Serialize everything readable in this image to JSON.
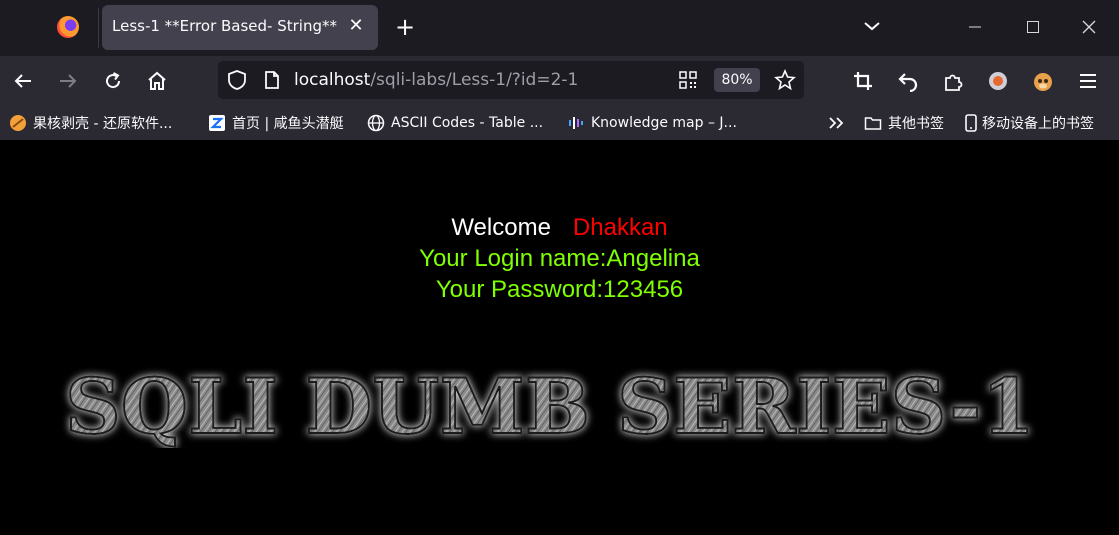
{
  "browser": {
    "tab": {
      "title": "Less-1 **Error Based- String**"
    },
    "url": {
      "host": "localhost",
      "path": "/sqli-labs/Less-1/?id=2-1"
    },
    "zoom": "80%",
    "bookmarks": [
      {
        "label": "果核剥壳 - 还原软件...",
        "icon": "guohe-icon"
      },
      {
        "label": "首页 | 咸鱼头潜艇",
        "icon": "zhihu-icon"
      },
      {
        "label": "ASCII Codes - Table ...",
        "icon": "globe-icon"
      },
      {
        "label": "Knowledge map – J...",
        "icon": "knowledge-icon"
      }
    ],
    "bookmarks_folder": "其他书签",
    "mobile_bookmarks": "移动设备上的书签"
  },
  "page": {
    "welcome": "Welcome",
    "welcome_name": "Dhakkan",
    "login_line": "Your Login name:Angelina",
    "password_line": "Your Password:123456",
    "banner_text": "SQLI DUMB SERIES-1"
  }
}
